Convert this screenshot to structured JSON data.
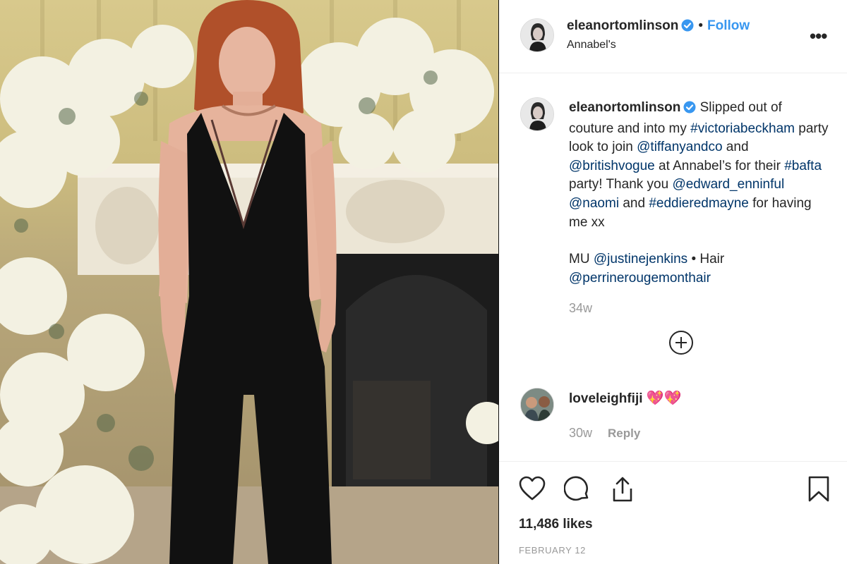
{
  "post": {
    "image": {
      "description_icon": "photo"
    },
    "header": {
      "username": "eleanortomlinson",
      "separator": "•",
      "follow_label": "Follow",
      "location": "Annabel's",
      "more_label": "•••"
    },
    "caption": {
      "username": "eleanortomlinson",
      "seg1": " Slipped out of couture and into my ",
      "tag_victoriabeckham": "#victoriabeckham",
      "seg2": " party look to join ",
      "mention_tiffanyandco": "@tiffanyandco",
      "seg3": " and ",
      "mention_britishvogue": "@britishvogue",
      "seg4": " at Annabel’s for their ",
      "tag_bafta": "#bafta",
      "seg5": " party! Thank you ",
      "mention_edward_enninful": "@edward_enninful",
      "seg6": " ",
      "mention_naomi": "@naomi",
      "seg7": " and ",
      "tag_eddieredmayne": "#eddieredmayne",
      "seg8": " for having me xx",
      "seg9": "MU ",
      "mention_justinejenkins": "@justinejenkins",
      "seg10": " • Hair ",
      "mention_perrinerougemonthair": "@perrinerougemonthair",
      "age": "34w"
    },
    "comment": {
      "username": "loveleighfiji",
      "emoji": "💖💖",
      "age": "30w",
      "reply_label": "Reply"
    },
    "likes": "11,486 likes",
    "date": "FEBRUARY 12"
  },
  "colors": {
    "accent": "#3897f0",
    "link": "#003569",
    "muted": "#999999",
    "text": "#262626"
  }
}
